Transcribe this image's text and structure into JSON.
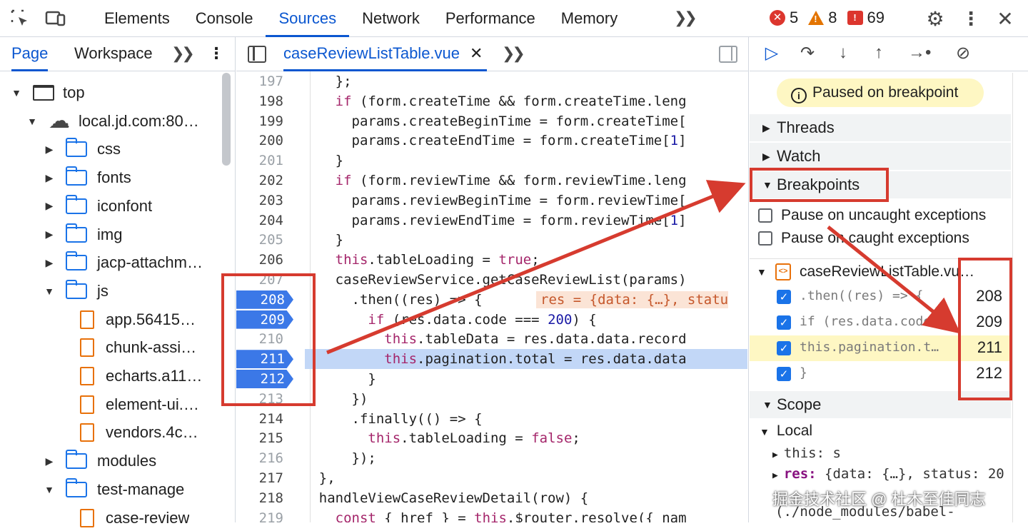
{
  "toolbar": {
    "tabs": [
      "Elements",
      "Console",
      "Sources",
      "Network",
      "Performance",
      "Memory"
    ],
    "errors": "5",
    "warnings": "8",
    "issues": "69"
  },
  "navigator": {
    "tabs": [
      "Page",
      "Workspace"
    ],
    "tree": [
      {
        "label": "top",
        "type": "frame",
        "expanded": true
      },
      {
        "label": "local.jd.com:80…",
        "type": "cloud",
        "expanded": true
      },
      {
        "label": "css",
        "type": "folder",
        "expanded": false
      },
      {
        "label": "fonts",
        "type": "folder",
        "expanded": false
      },
      {
        "label": "iconfont",
        "type": "folder",
        "expanded": false
      },
      {
        "label": "img",
        "type": "folder",
        "expanded": false
      },
      {
        "label": "jacp-attachm…",
        "type": "folder",
        "expanded": false
      },
      {
        "label": "js",
        "type": "folder",
        "expanded": true
      },
      {
        "label": "app.56415…",
        "type": "file"
      },
      {
        "label": "chunk-assi…",
        "type": "file"
      },
      {
        "label": "echarts.a11…",
        "type": "file"
      },
      {
        "label": "element-ui.…",
        "type": "file"
      },
      {
        "label": "vendors.4c…",
        "type": "file"
      },
      {
        "label": "modules",
        "type": "folder",
        "expanded": false
      },
      {
        "label": "test-manage",
        "type": "folder",
        "expanded": true
      },
      {
        "label": "case-review",
        "type": "file"
      }
    ]
  },
  "editor": {
    "file_tab": "caseReviewListTable.vue",
    "line_numbers": [
      "197",
      "198",
      "199",
      "200",
      "201",
      "202",
      "203",
      "204",
      "205",
      "206",
      "207",
      "208",
      "209",
      "210",
      "211",
      "212",
      "213",
      "214",
      "215",
      "216",
      "217",
      "218",
      "219"
    ],
    "breakpoint_lines": [
      "208",
      "209",
      "211",
      "212"
    ],
    "lines": [
      "      };",
      "      if (form.createTime && form.createTime.leng",
      "        params.createBeginTime = form.createTime[",
      "        params.createEndTime = form.createTime[1]",
      "      }",
      "      if (form.reviewTime && form.reviewTime.leng",
      "        params.reviewBeginTime = form.reviewTime[",
      "        params.reviewEndTime = form.reviewTime[1]",
      "      }",
      "      this.tableLoading = true;",
      "      caseReviewService.getCaseReviewList(params)",
      "        .then((res) => {",
      "          if (res.data.code === 200) {",
      "            this.tableData = res.data.data.record",
      "            this.pagination.total = res.data.data",
      "          }",
      "        })",
      "        .finally(() => {",
      "          this.tableLoading = false;",
      "        });",
      "    },",
      "    handleViewCaseReviewDetail(row) {",
      "      const { href } = this.$router.resolve({ nam"
    ],
    "inline_value": "res = {data: {…}, statu"
  },
  "debugger": {
    "paused_label": "Paused on breakpoint",
    "sections": {
      "threads": "Threads",
      "watch": "Watch",
      "breakpoints": "Breakpoints",
      "scope": "Scope",
      "local": "Local"
    },
    "pause_uncaught": "Pause on uncaught exceptions",
    "pause_caught": "Pause on caught exceptions",
    "bp_file": "caseReviewListTable.vu…",
    "breakpoints": [
      {
        "code": ".then((res) => {",
        "line": "208"
      },
      {
        "code": "if (res.data.code…",
        "line": "209"
      },
      {
        "code": "this.pagination.t…",
        "line": "211"
      },
      {
        "code": "}",
        "line": "212"
      }
    ],
    "scope_this": "this: s",
    "scope_res_key": "res:",
    "scope_res_val": "{data: {…}, status: 20",
    "scope_path": "(./node_modules/babel-"
  },
  "watermark": "掘金技术社区 @ 杜木至佳同志",
  "colors": {
    "accent": "#0b57d0",
    "breakpoint": "#3b78e7",
    "annotation": "#d63b2f",
    "paused_bg": "#fef7c3"
  }
}
